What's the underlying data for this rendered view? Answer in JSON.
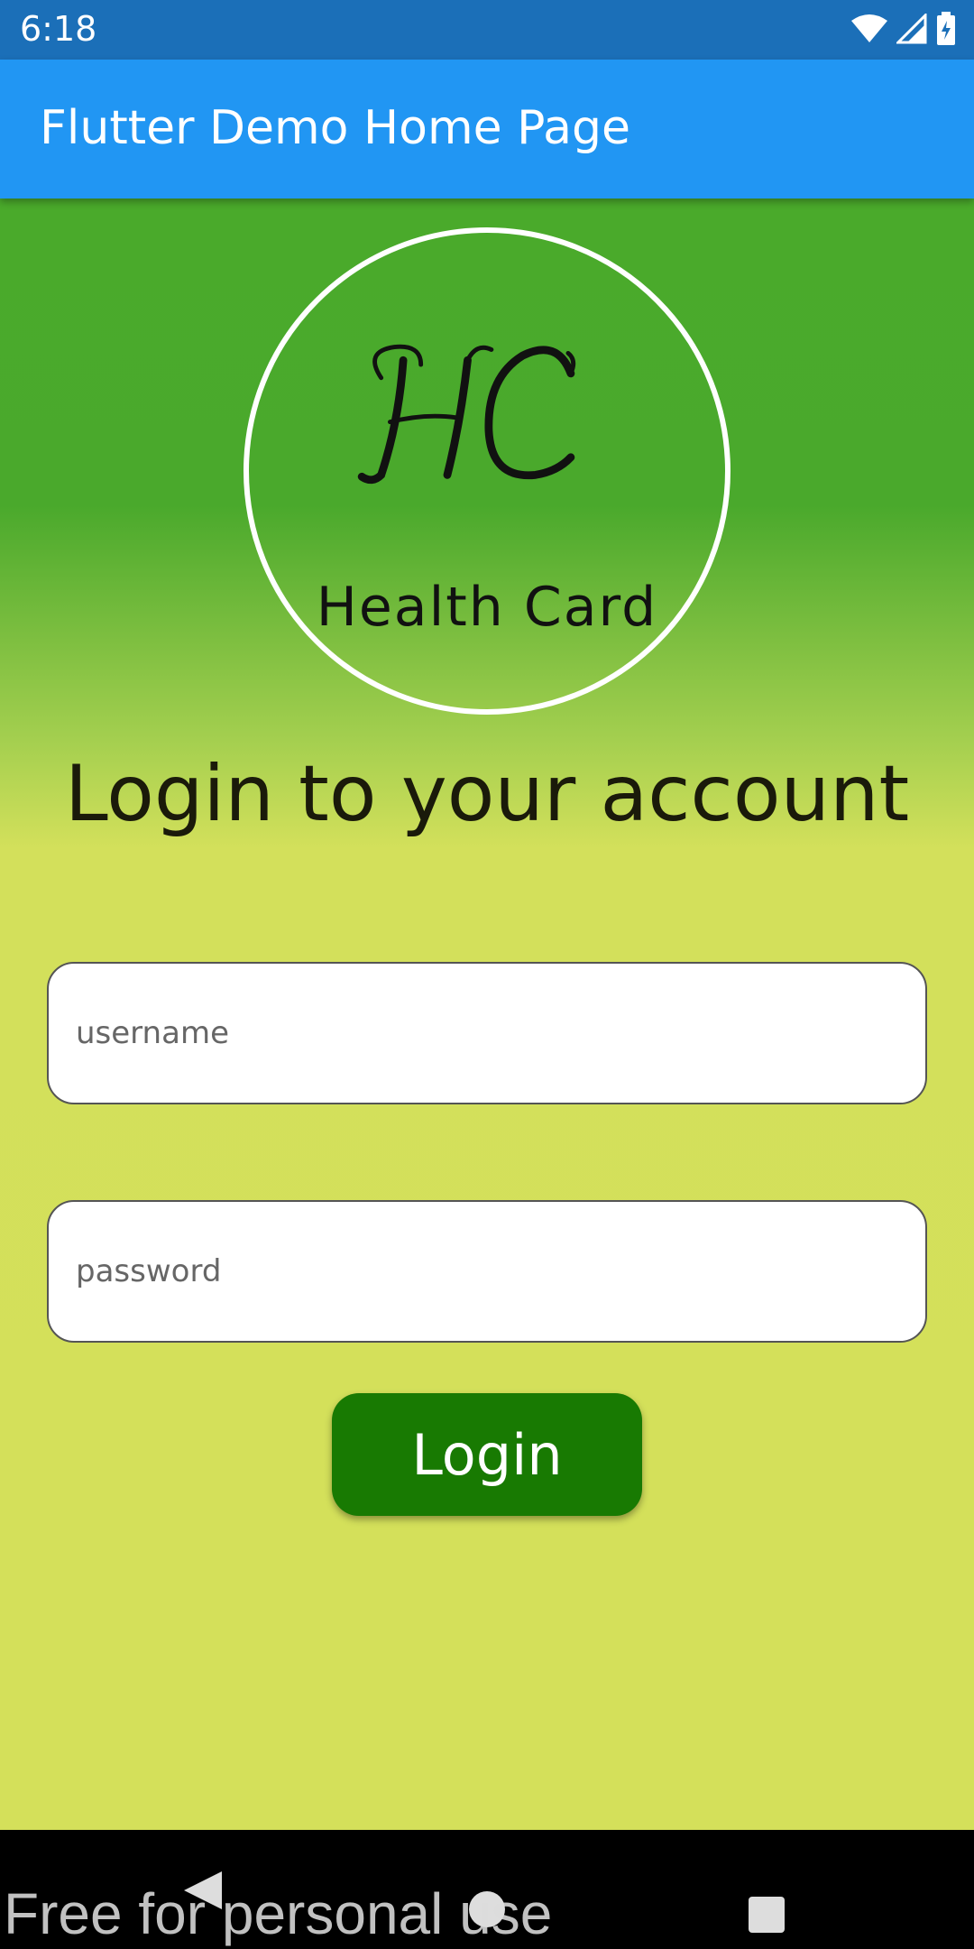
{
  "status_bar": {
    "time": "6:18",
    "icons": [
      "wifi-icon",
      "cell-signal-icon",
      "battery-icon"
    ]
  },
  "app_bar": {
    "title": "Flutter Demo Home Page",
    "color": "#2196f3"
  },
  "logo": {
    "monogram": "HC",
    "caption": "Health Card"
  },
  "heading": "Login to your account",
  "form": {
    "username_placeholder": "username",
    "password_placeholder": "password",
    "login_label": "Login",
    "login_color": "#187a02"
  },
  "nav_bar": {
    "icons": [
      "back-icon",
      "home-icon",
      "recents-icon"
    ]
  },
  "watermark": "Free for personal use"
}
